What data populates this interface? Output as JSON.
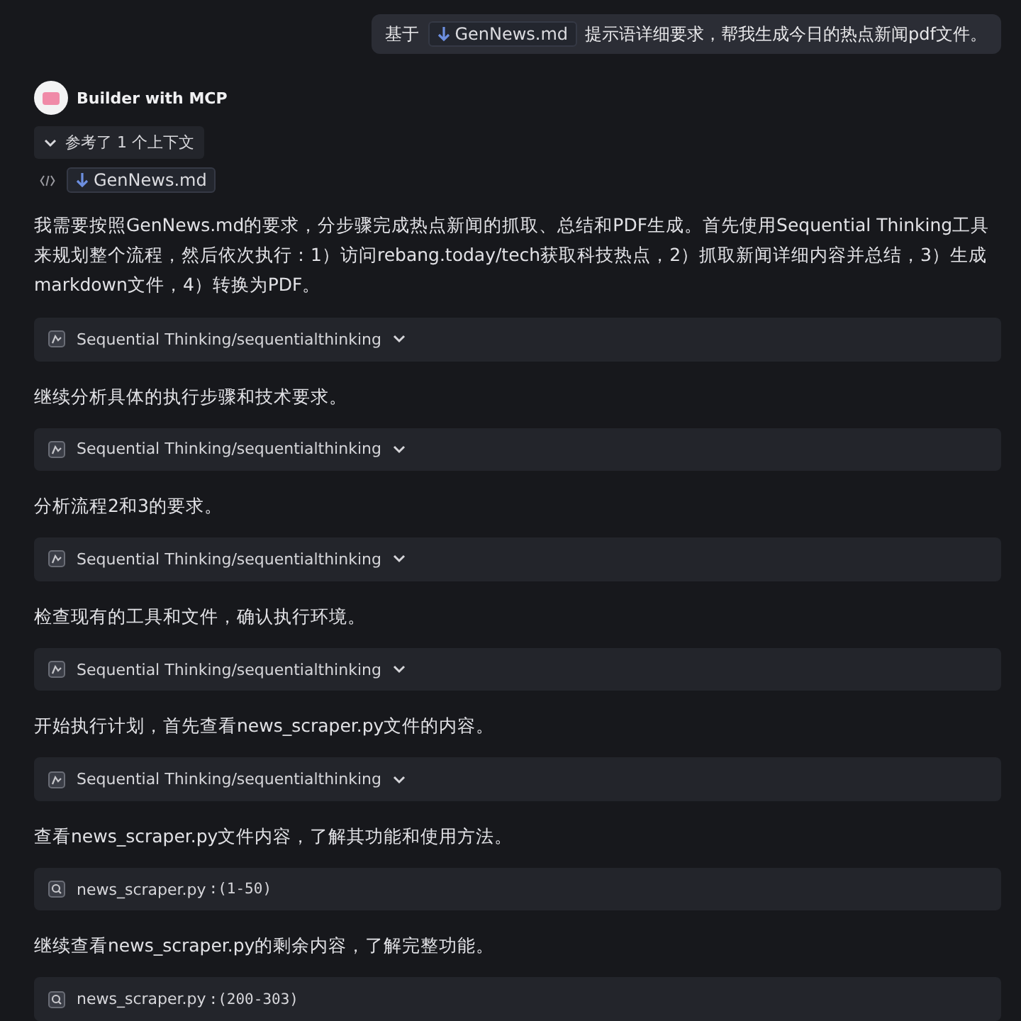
{
  "user_message": {
    "before": "基于",
    "file": "GenNews.md",
    "after": "提示语详细要求，帮我生成今日的热点新闻pdf文件。"
  },
  "assistant": {
    "name": "Builder with MCP",
    "context_toggle": {
      "label": "参考了 1 个上下文",
      "expanded": true
    },
    "context_file": "GenNews.md",
    "intro": "我需要按照GenNews.md的要求，分步骤完成热点新闻的抓取、总结和PDF生成。首先使用Sequential Thinking工具来规划整个流程，然后依次执行：1）访问rebang.today/tech获取科技热点，2）抓取新闻详细内容并总结，3）生成markdown文件，4）转换为PDF。",
    "steps": [
      {
        "tool": {
          "kind": "thinking",
          "label": "Sequential Thinking/sequentialthinking"
        },
        "text": "继续分析具体的执行步骤和技术要求。"
      },
      {
        "tool": {
          "kind": "thinking",
          "label": "Sequential Thinking/sequentialthinking"
        },
        "text": "分析流程2和3的要求。"
      },
      {
        "tool": {
          "kind": "thinking",
          "label": "Sequential Thinking/sequentialthinking"
        },
        "text": "检查现有的工具和文件，确认执行环境。"
      },
      {
        "tool": {
          "kind": "thinking",
          "label": "Sequential Thinking/sequentialthinking"
        },
        "text": "开始执行计划，首先查看news_scraper.py文件的内容。"
      },
      {
        "tool": {
          "kind": "thinking",
          "label": "Sequential Thinking/sequentialthinking"
        },
        "text": "查看news_scraper.py文件内容，了解其功能和使用方法。"
      },
      {
        "tool": {
          "kind": "search",
          "label": "news_scraper.py",
          "range": ":(1-50)"
        },
        "text": "继续查看news_scraper.py的剩余内容，了解完整功能。"
      },
      {
        "tool": {
          "kind": "search",
          "label": "news_scraper.py",
          "range": ":(200-303)"
        }
      }
    ]
  }
}
